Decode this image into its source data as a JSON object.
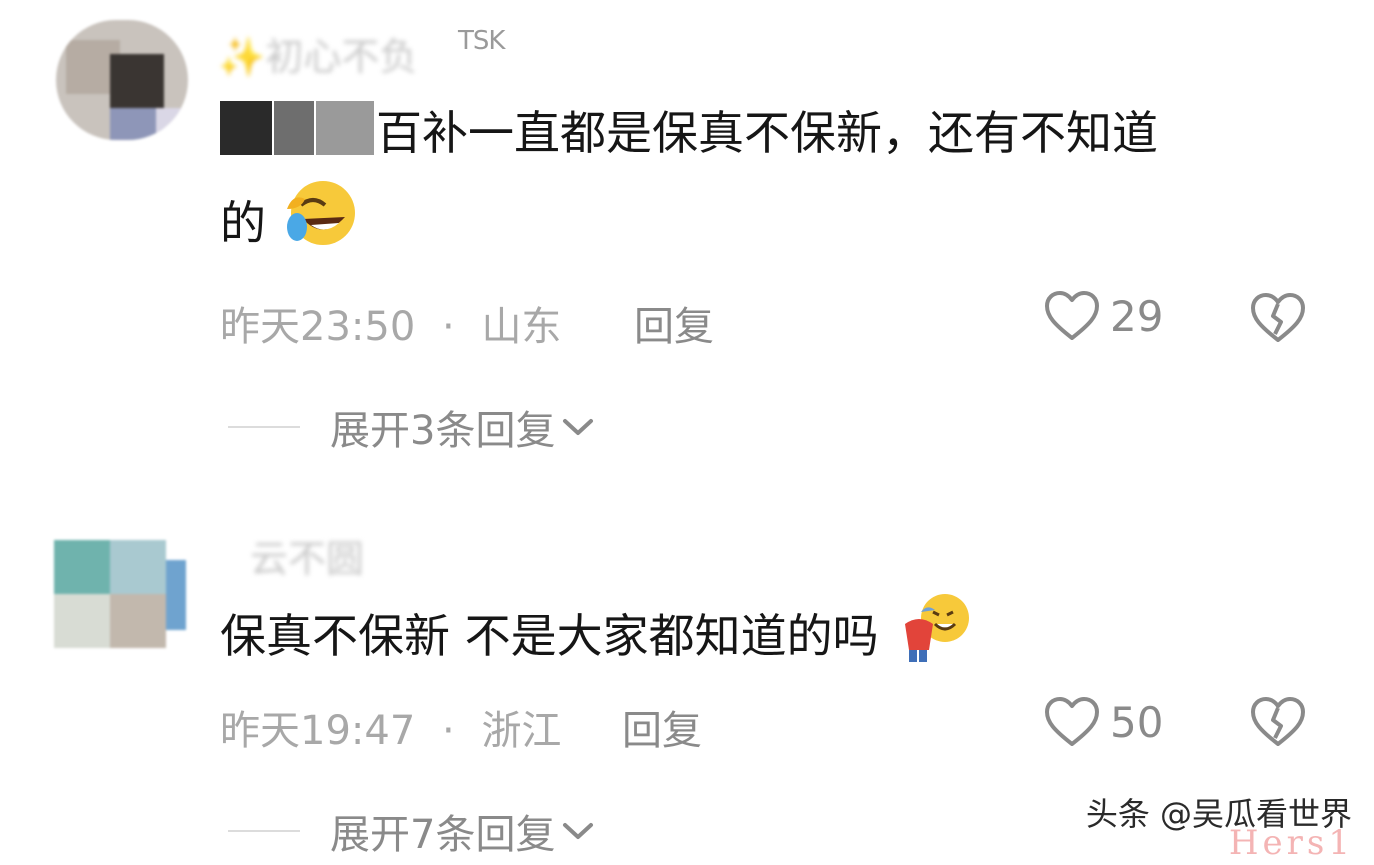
{
  "comments": [
    {
      "username": "✨初心不负",
      "badge": "TSK",
      "text": "百补一直都是保真不保新，还有不知道",
      "text_line2": "的",
      "time": "昨天23:50",
      "location": "山东",
      "separator": "·",
      "reply_label": "回复",
      "likes": "29",
      "expand_label": "展开3条回复",
      "emoji_icon": "rolling-laughing-emoji-icon"
    },
    {
      "username": "云不圆",
      "text": "保真不保新 不是大家都知道的吗",
      "time": "昨天19:47",
      "location": "浙江",
      "separator": "·",
      "reply_label": "回复",
      "likes": "50",
      "expand_label": "展开7条回复",
      "emoji_icon": "bowing-laughing-emoji-icon"
    }
  ],
  "watermark": "头条 @吴瓜看世界",
  "corner_mark": "Hers1",
  "colors": {
    "meta": "#a8a8a8",
    "reply": "#8a8a8a",
    "text": "#161616"
  }
}
